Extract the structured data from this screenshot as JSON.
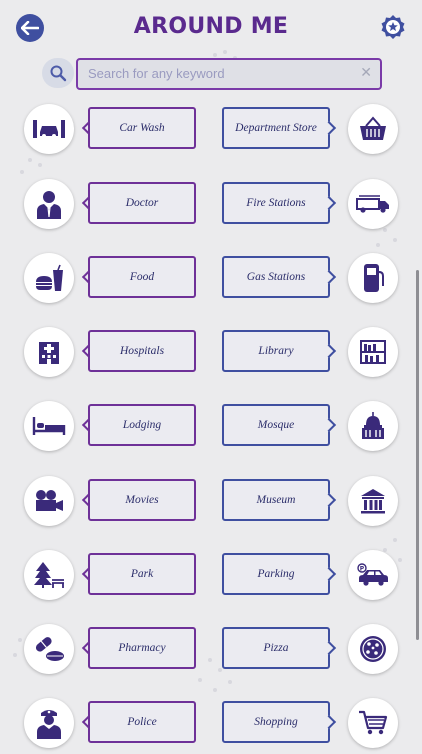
{
  "header": {
    "title": "AROUND ME",
    "back_icon": "back-arrow-icon",
    "favorite_icon": "star-badge-icon"
  },
  "search": {
    "placeholder": "Search for any keyword",
    "clear_label": "✕"
  },
  "colors": {
    "purple": "#6e3198",
    "blue": "#3f4fa0",
    "title": "#5a2a8e"
  },
  "categories": {
    "left": [
      {
        "label": "Car Wash",
        "icon": "car-wash-icon"
      },
      {
        "label": "Doctor",
        "icon": "doctor-icon"
      },
      {
        "label": "Food",
        "icon": "food-icon"
      },
      {
        "label": "Hospitals",
        "icon": "hospital-icon"
      },
      {
        "label": "Lodging",
        "icon": "bed-icon"
      },
      {
        "label": "Movies",
        "icon": "movie-camera-icon"
      },
      {
        "label": "Park",
        "icon": "park-icon"
      },
      {
        "label": "Pharmacy",
        "icon": "pills-icon"
      },
      {
        "label": "Police",
        "icon": "police-icon"
      }
    ],
    "right": [
      {
        "label": "Department Store",
        "icon": "basket-icon"
      },
      {
        "label": "Fire Stations",
        "icon": "fire-truck-icon"
      },
      {
        "label": "Gas Stations",
        "icon": "fuel-pump-icon"
      },
      {
        "label": "Library",
        "icon": "bookshelf-icon"
      },
      {
        "label": "Mosque",
        "icon": "dome-icon"
      },
      {
        "label": "Museum",
        "icon": "museum-icon"
      },
      {
        "label": "Parking",
        "icon": "parking-car-icon"
      },
      {
        "label": "Pizza",
        "icon": "pizza-icon"
      },
      {
        "label": "Shopping",
        "icon": "shopping-cart-icon"
      }
    ]
  }
}
